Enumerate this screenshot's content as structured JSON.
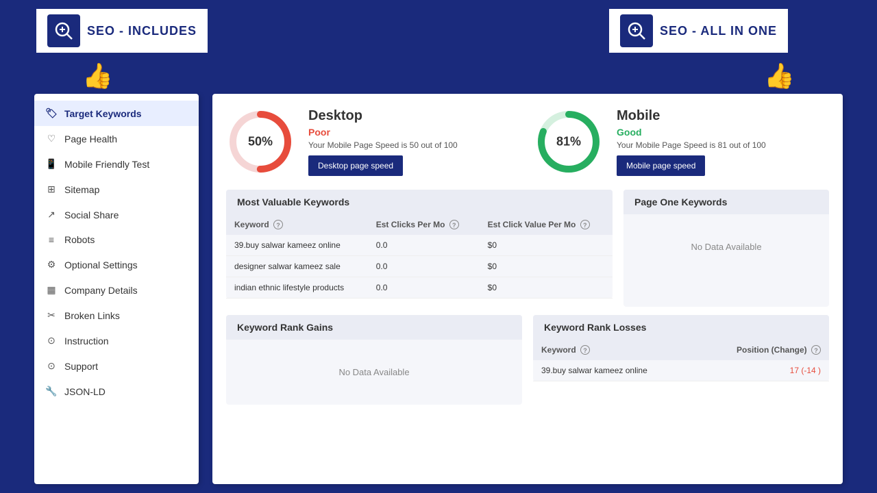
{
  "header": {
    "logo1_text": "SEO - INCLUDES",
    "logo2_text": "SEO - ALL IN ONE"
  },
  "sidebar": {
    "items": [
      {
        "id": "target-keywords",
        "label": "Target Keywords",
        "icon": "🏷",
        "active": true
      },
      {
        "id": "page-health",
        "label": "Page Health",
        "icon": "♡"
      },
      {
        "id": "mobile-friendly",
        "label": "Mobile Friendly Test",
        "icon": "📱"
      },
      {
        "id": "sitemap",
        "label": "Sitemap",
        "icon": "⊞"
      },
      {
        "id": "social-share",
        "label": "Social Share",
        "icon": "↗"
      },
      {
        "id": "robots",
        "label": "Robots",
        "icon": "≡"
      },
      {
        "id": "optional-settings",
        "label": "Optional Settings",
        "icon": "⚙"
      },
      {
        "id": "company-details",
        "label": "Company Details",
        "icon": "▦"
      },
      {
        "id": "broken-links",
        "label": "Broken Links",
        "icon": "✂"
      },
      {
        "id": "instruction",
        "label": "Instruction",
        "icon": "⊙"
      },
      {
        "id": "support",
        "label": "Support",
        "icon": "⊙"
      },
      {
        "id": "json-ld",
        "label": "JSON-LD",
        "icon": "🔧"
      }
    ]
  },
  "desktop": {
    "title": "Desktop",
    "percentage": "50%",
    "score": 50,
    "status": "Poor",
    "description": "Your Mobile Page Speed is 50 out of 100",
    "button_label": "Desktop page speed",
    "color": "#e74c3c",
    "bg_color": "#fde8e8"
  },
  "mobile": {
    "title": "Mobile",
    "percentage": "81%",
    "score": 81,
    "status": "Good",
    "description": "Your Mobile Page Speed is 81 out of 100",
    "button_label": "Mobile page speed",
    "color": "#27ae60",
    "bg_color": "#e8f8ee"
  },
  "most_valuable_keywords": {
    "title": "Most Valuable Keywords",
    "columns": [
      "Keyword",
      "Est Clicks Per Mo",
      "Est Click Value Per Mo"
    ],
    "rows": [
      {
        "keyword": "39.buy salwar kameez online",
        "clicks": "0.0",
        "value": "$0"
      },
      {
        "keyword": "designer salwar kameez sale",
        "clicks": "0.0",
        "value": "$0"
      },
      {
        "keyword": "indian ethnic lifestyle products",
        "clicks": "0.0",
        "value": "$0"
      }
    ]
  },
  "page_one_keywords": {
    "title": "Page One Keywords",
    "no_data": "No Data Available"
  },
  "keyword_rank_gains": {
    "title": "Keyword Rank Gains",
    "no_data": "No Data Available"
  },
  "keyword_rank_losses": {
    "title": "Keyword Rank Losses",
    "columns": [
      "Keyword",
      "Position (Change)"
    ],
    "rows": [
      {
        "keyword": "39.buy salwar kameez online",
        "position": "17 (-14  )"
      }
    ]
  }
}
